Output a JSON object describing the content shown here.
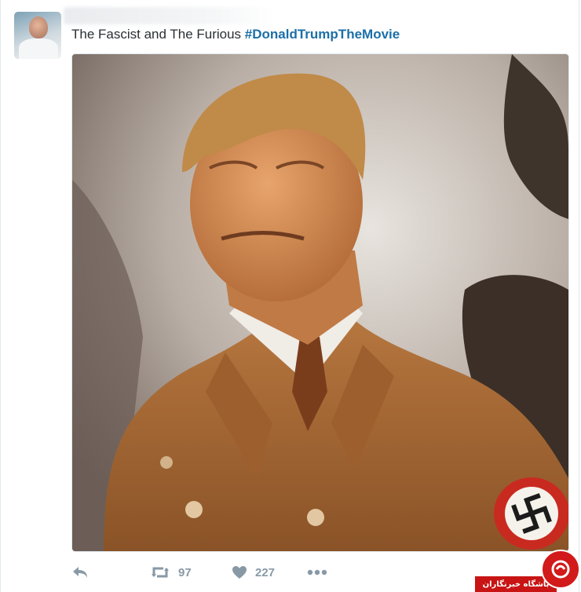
{
  "tweet": {
    "text": "The Fascist and The Furious ",
    "hashtag": "#DonaldTrumpTheMovie",
    "avatar_icon": "user-avatar"
  },
  "actions": {
    "reply_icon": "reply-icon",
    "retweet_icon": "retweet-icon",
    "retweet_count": "97",
    "like_icon": "heart-icon",
    "like_count": "227",
    "more_icon": "more-icon"
  },
  "watermark": {
    "text": "باشگاه خبرنگاران"
  },
  "colors": {
    "hashtag": "#1b6fa8",
    "action_gray": "#8899a6",
    "watermark_red": "#c81414"
  }
}
